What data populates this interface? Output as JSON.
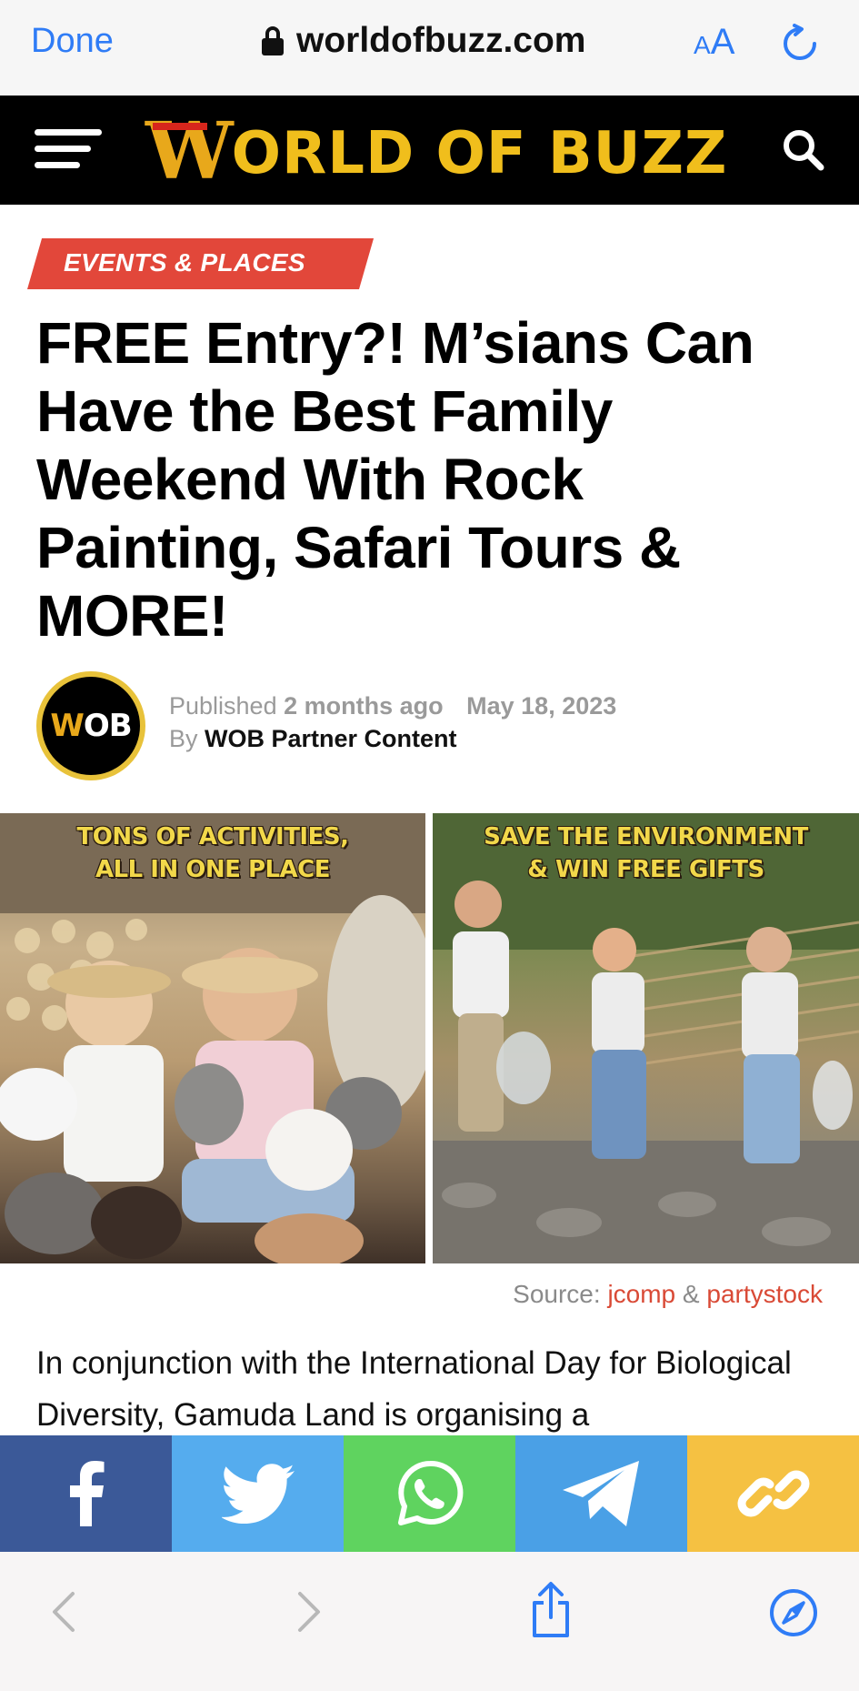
{
  "browser": {
    "done_label": "Done",
    "url": "worldofbuzz.com",
    "text_size_small": "A",
    "text_size_big": "A",
    "accent_color": "#2f7cf6"
  },
  "site": {
    "logo_w": "W",
    "logo_rest": "ORLD OF BUZZ",
    "header_bg": "#000000",
    "logo_color": "#f0be1c"
  },
  "article": {
    "category": "EVENTS & PLACES",
    "category_color": "#e2473a",
    "headline": "FREE Entry?! M’sians Can Have the Best Family Weekend With Rock Painting, Safari Tours & MORE!",
    "avatar_text_w": "W",
    "avatar_text_rest": "OB",
    "published_label": "Published",
    "published_relative": "2 months ago",
    "published_date": "May 18, 2023",
    "by_label": "By",
    "author": "WOB Partner Content",
    "image_caption_left_line1": "TONS OF ACTIVITIES,",
    "image_caption_left_line2": "ALL IN ONE PLACE",
    "image_caption_right_line1": "SAVE THE ENVIRONMENT",
    "image_caption_right_line2": "& WIN FREE GIFTS",
    "source_label": "Source:",
    "source_link_1": "jcomp",
    "source_amp": "&",
    "source_link_2": "partystock",
    "body_text": "In conjunction with the International Day for Biological Diversity, Gamuda Land is organising a"
  },
  "share": [
    {
      "icon": "facebook-icon",
      "color": "#3b5998"
    },
    {
      "icon": "twitter-icon",
      "color": "#55acee"
    },
    {
      "icon": "whatsapp-icon",
      "color": "#5fd35f"
    },
    {
      "icon": "telegram-icon",
      "color": "#4aa0e6"
    },
    {
      "icon": "link-icon",
      "color": "#f5c142"
    }
  ]
}
